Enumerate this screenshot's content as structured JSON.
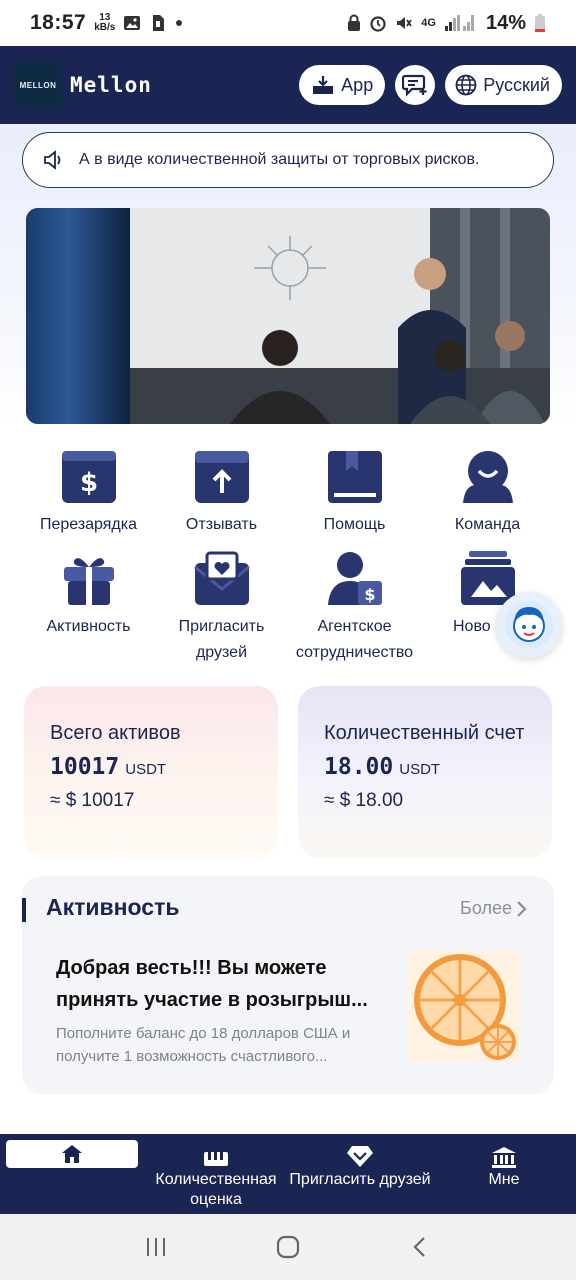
{
  "status_bar": {
    "time": "18:57",
    "net_speed_value": "13",
    "net_speed_unit": "kB/s",
    "network": "4G",
    "battery": "14%"
  },
  "header": {
    "logo_text": "MELLON",
    "app_name": "Mellon",
    "app_button": "App",
    "language": "Русский"
  },
  "notice": {
    "text": "А в виде количественной защиты от торговых рисков."
  },
  "quick_actions": [
    {
      "label": "Перезарядка",
      "icon": "recharge-icon"
    },
    {
      "label": "Отзывать",
      "icon": "withdraw-icon"
    },
    {
      "label": "Помощь",
      "icon": "help-book-icon"
    },
    {
      "label": "Команда",
      "icon": "team-icon"
    },
    {
      "label": "Активность",
      "icon": "gift-icon"
    },
    {
      "label": "Пригласить друзей",
      "icon": "invite-envelope-icon"
    },
    {
      "label": "Агентское сотрудничество",
      "icon": "agent-icon"
    },
    {
      "label": "Ново",
      "icon": "news-icon"
    }
  ],
  "assets": {
    "total": {
      "title": "Всего активов",
      "amount": "10017",
      "unit": "USDT",
      "approx": "≈ $ 10017"
    },
    "quant": {
      "title": "Количественный счет",
      "amount": "18.00",
      "unit": "USDT",
      "approx": "≈ $ 18.00"
    }
  },
  "activity": {
    "title": "Активность",
    "more": "Более",
    "news_title": "Добрая весть!!! Вы можете принять участие в розыгрыш...",
    "news_desc": "Пополните баланс до 18 долларов США и получите 1 возможность счастливого..."
  },
  "tabs": [
    {
      "label": "",
      "icon": "home-icon",
      "active": true
    },
    {
      "label": "Количественная оценка",
      "icon": "quant-icon"
    },
    {
      "label": "Пригласить друзей",
      "icon": "invite-diamond-icon"
    },
    {
      "label": "Мне",
      "icon": "bank-icon"
    }
  ],
  "colors": {
    "navy": "#1a2553",
    "accent_orange": "#f4a04a"
  }
}
